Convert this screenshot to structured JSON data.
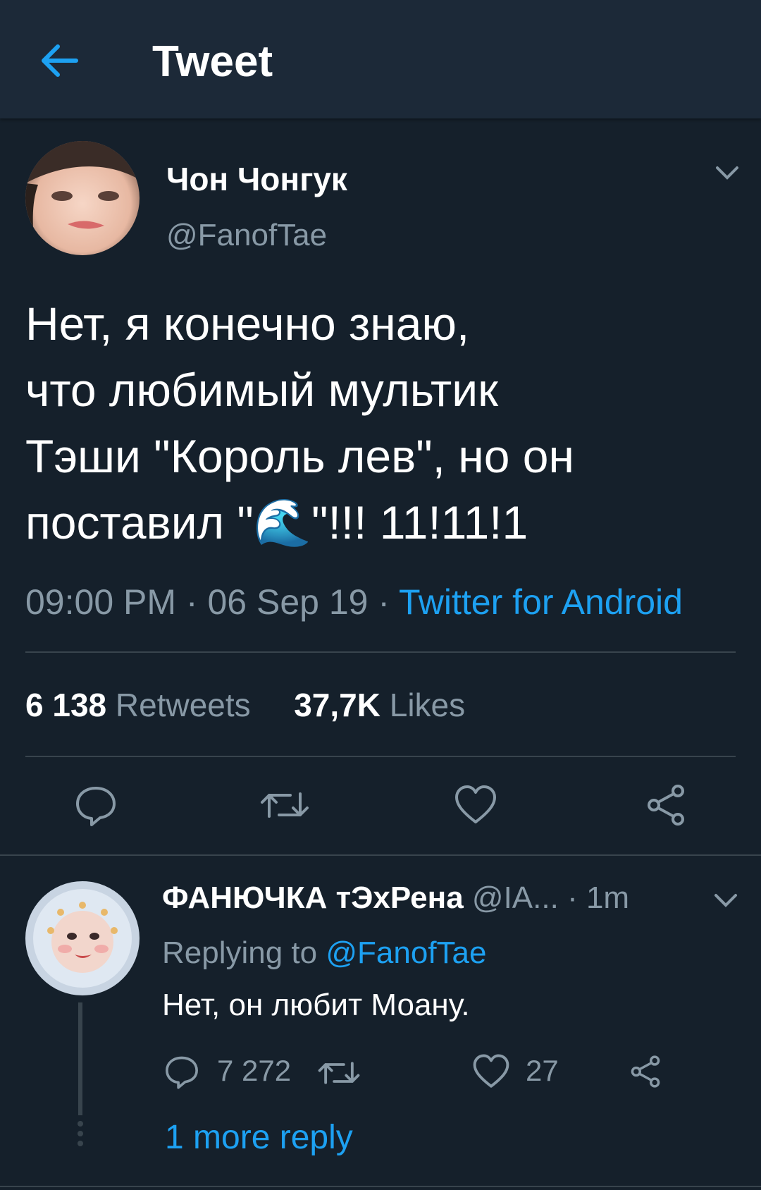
{
  "header": {
    "title": "Tweet",
    "back_icon": "arrow-left-icon"
  },
  "tweet": {
    "author_name": "Чон Чонгук",
    "author_handle": "@FanofTae",
    "text_lines": [
      "Нет, я конечно знаю,",
      "что любимый мультик",
      "Тэши \"Король лев\", но он",
      "поставил \"🌊\"!!! 11!11!1"
    ],
    "time": "09:00 PM",
    "date": "06 Sep 19",
    "source": "Twitter for Android",
    "retweets_count": "6 138",
    "retweets_label": "Retweets",
    "likes_count": "37,7K",
    "likes_label": "Likes"
  },
  "reply": {
    "author_name": "ФАНЮЧКА тЭхРена",
    "author_handle": "@IA...",
    "age": "1m",
    "replying_to_label": "Replying to",
    "replying_to_handle": "@FanofTae",
    "text": "Нет, он любит Моану.",
    "reply_count": "7 272",
    "like_count": "27",
    "more_replies": "1 more reply"
  },
  "colors": {
    "background": "#15202b",
    "header_bg": "#1c2938",
    "accent": "#1da1f2",
    "secondary_text": "#8899a6",
    "divider": "#38444d"
  }
}
